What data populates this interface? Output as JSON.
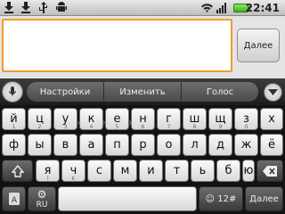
{
  "status": {
    "time": "22:41",
    "icons": [
      "download-icon",
      "download-icon",
      "usb-icon",
      "android-debug-icon",
      "wifi-icon",
      "signal-icon",
      "battery-icon"
    ]
  },
  "compose": {
    "text_value": "",
    "next_label": "Далее"
  },
  "suggestions": {
    "items": [
      {
        "label": "Настройки"
      },
      {
        "label": "Изменить"
      },
      {
        "label": "Голос"
      }
    ]
  },
  "keyboard": {
    "row1": [
      "й",
      "ц",
      "у",
      "к",
      "е",
      "н",
      "г",
      "ш",
      "щ",
      "з",
      "х"
    ],
    "row2": [
      "ф",
      "ы",
      "в",
      "а",
      "п",
      "р",
      "о",
      "л",
      "д",
      "ж",
      "э"
    ],
    "row3": [
      "я",
      "ч",
      "с",
      "м",
      "и",
      "т",
      "ь",
      "б",
      "ю"
    ],
    "row1_hints": [
      "1",
      "2",
      "3",
      "4",
      "5",
      "6",
      "7",
      "8",
      "9",
      "0",
      ""
    ],
    "row2_hints": [
      "",
      "",
      "",
      "",
      "",
      "",
      "",
      "",
      "",
      "",
      ""
    ],
    "row3_hints": [
      ")",
      "€",
      "",
      "",
      "",
      "",
      "",
      "",
      ""
    ],
    "row1_extra": "ё",
    "lang_label": "RU",
    "symbols_label": "12#",
    "enter_label": "Далее"
  },
  "watermark": "mobile-review.com",
  "colors": {
    "focus_border": "#f29a2e"
  }
}
